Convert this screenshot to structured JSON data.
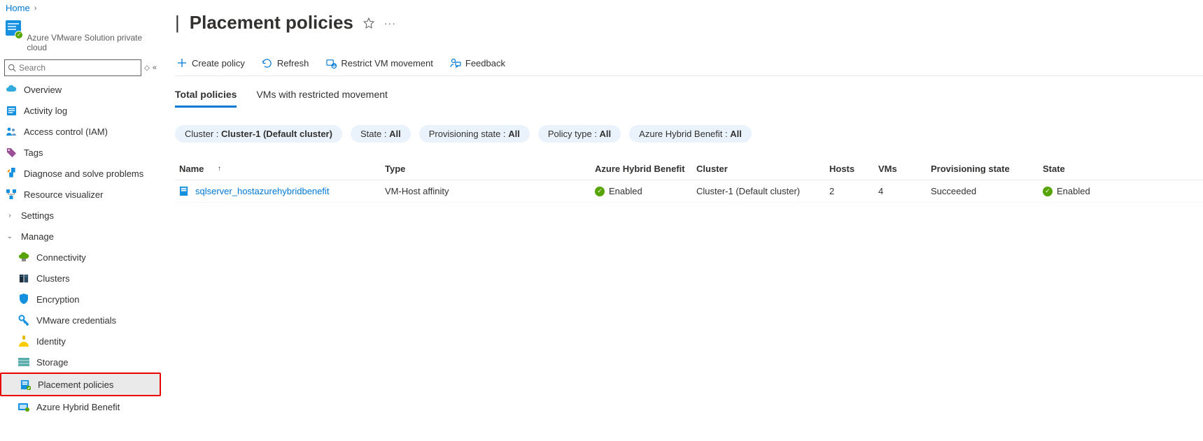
{
  "breadcrumb": {
    "home": "Home"
  },
  "resource": {
    "subtitle": "Azure VMware Solution private cloud"
  },
  "search": {
    "placeholder": "Search"
  },
  "sidebar": {
    "overview": "Overview",
    "activity_log": "Activity log",
    "iam": "Access control (IAM)",
    "tags": "Tags",
    "diagnose": "Diagnose and solve problems",
    "resource_visualizer": "Resource visualizer",
    "settings": "Settings",
    "manage": "Manage",
    "connectivity": "Connectivity",
    "clusters": "Clusters",
    "encryption": "Encryption",
    "vmware_credentials": "VMware credentials",
    "identity": "Identity",
    "storage": "Storage",
    "placement_policies": "Placement policies",
    "ahb": "Azure Hybrid Benefit"
  },
  "page": {
    "title": "Placement policies"
  },
  "toolbar": {
    "create": "Create policy",
    "refresh": "Refresh",
    "restrict": "Restrict VM movement",
    "feedback": "Feedback"
  },
  "tabs": {
    "total": "Total policies",
    "restricted": "VMs with restricted movement"
  },
  "filters": {
    "cluster_label": "Cluster : ",
    "cluster_value": "Cluster-1 (Default cluster)",
    "state_label": "State : ",
    "state_value": "All",
    "prov_label": "Provisioning state : ",
    "prov_value": "All",
    "ptype_label": "Policy type : ",
    "ptype_value": "All",
    "ahb_label": "Azure Hybrid Benefit : ",
    "ahb_value": "All"
  },
  "table": {
    "headers": {
      "name": "Name",
      "type": "Type",
      "ahb": "Azure Hybrid Benefit",
      "cluster": "Cluster",
      "hosts": "Hosts",
      "vms": "VMs",
      "prov": "Provisioning state",
      "state": "State"
    },
    "rows": [
      {
        "name": "sqlserver_hostazurehybridbenefit",
        "type": "VM-Host affinity",
        "ahb": "Enabled",
        "cluster": "Cluster-1 (Default cluster)",
        "hosts": "2",
        "vms": "4",
        "prov": "Succeeded",
        "state": "Enabled"
      }
    ]
  }
}
